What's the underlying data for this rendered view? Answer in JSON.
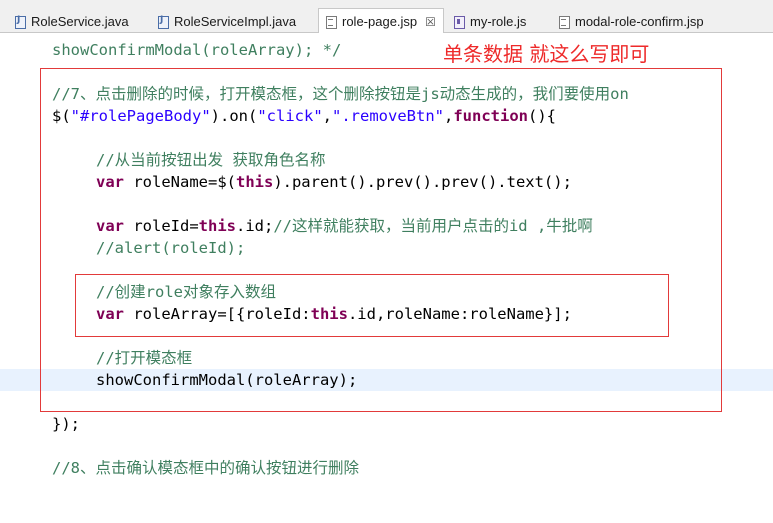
{
  "tabs": [
    {
      "label": "RoleService.java",
      "icon": "java-file-icon",
      "active": false
    },
    {
      "label": "RoleServiceImpl.java",
      "icon": "java-file-icon",
      "active": false
    },
    {
      "label": "role-page.jsp",
      "icon": "jsp-file-icon",
      "active": true,
      "close": "☒"
    },
    {
      "label": "my-role.js",
      "icon": "js-file-icon",
      "active": false
    },
    {
      "label": "modal-role-confirm.jsp",
      "icon": "jsp-file-icon",
      "active": false
    }
  ],
  "annotation": "单条数据 就这么写即可",
  "code": {
    "l1": "showConfirmModal(roleArray); */",
    "l2": "//7、点击删除的时候，打开模态框，这个删除按钮是js动态生成的，我们要使用on",
    "l3a": "$(",
    "l3b": "\"#rolePageBody\"",
    "l3c": ").on(",
    "l3d": "\"click\"",
    "l3e": ",",
    "l3f": "\".removeBtn\"",
    "l3g": ",",
    "l3h": "function",
    "l3i": "(){",
    "l4": "//从当前按钮出发 获取角色名称",
    "l5a": "var",
    "l5b": " roleName=$(",
    "l5c": "this",
    "l5d": ").parent().prev().prev().text();",
    "l6a": "var",
    "l6b": " roleId=",
    "l6c": "this",
    "l6d": ".id;",
    "l6e": "//这样就能获取，当前用户点击的id ,牛批啊",
    "l7": "//alert(roleId);",
    "l8": "//创建role对象存入数组",
    "l9a": "var",
    "l9b": " roleArray=[{roleId:",
    "l9c": "this",
    "l9d": ".id,roleName:roleName}];",
    "l10": "//打开模态框",
    "l11": "showConfirmModal(roleArray);",
    "l12": "});",
    "l13": "//8、点击确认模态框中的确认按钮进行删除"
  }
}
